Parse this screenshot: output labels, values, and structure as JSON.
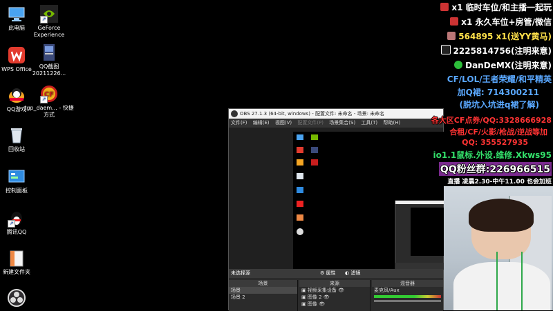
{
  "desktop": {
    "icons": [
      {
        "label": "此电脑",
        "icon": "computer-icon"
      },
      {
        "label": "GeForce Experience",
        "icon": "geforce-icon"
      },
      {
        "label": "WPS Office",
        "icon": "wps-icon"
      },
      {
        "label": "QQ截图 20211226...",
        "icon": "image-file-icon"
      },
      {
        "label": "QQ游戏",
        "icon": "qq-game-icon"
      },
      {
        "label": "tgp_daem... - 快捷方式",
        "icon": "cf-icon"
      },
      {
        "label": "回收站",
        "icon": "recycle-bin-icon"
      },
      {
        "label": "控制面板",
        "icon": "control-panel-icon"
      },
      {
        "label": "腾讯QQ",
        "icon": "qq-icon"
      },
      {
        "label": "新建文件夹",
        "icon": "folder-icon"
      },
      {
        "label": "",
        "icon": "obs-icon"
      }
    ]
  },
  "obs": {
    "title": "OBS 27.1.3 (64-bit, windows) - 配置文件: 未命名 - 场景: 未命名",
    "menu": [
      "文件(F)",
      "编辑(E)",
      "视图(V)",
      "配置文件(P)",
      "场景集合(S)",
      "工具(T)",
      "帮助(H)"
    ],
    "source_bar": {
      "label": "未选择源",
      "properties": "属性",
      "filters": "滤镜"
    },
    "docks": {
      "scenes": {
        "title": "场景",
        "items": [
          "场景",
          "场景 2"
        ]
      },
      "sources": {
        "title": "来源",
        "items": [
          "视频采集设备",
          "图像 2",
          "图像"
        ]
      },
      "mixer": {
        "title": "混音器",
        "track": "麦克风/Aux"
      }
    }
  },
  "overlay": {
    "lines": [
      {
        "text": "x1 临时车位/和主播一起玩",
        "color": "#ffffff",
        "icon": "car-icon"
      },
      {
        "text": "x1 永久车位+房管/微信",
        "color": "#ffffff",
        "icon": "car-icon"
      },
      {
        "text": "564895 x1(送YY黄马)",
        "color": "#ffe14a",
        "icon": "owl-icon"
      },
      {
        "text": "2225814756(注明来意)",
        "color": "#ffffff",
        "icon": "qq-penguin-icon"
      },
      {
        "text": "DanDeMX(注明来意)",
        "color": "#ffffff",
        "icon": "wechat-icon"
      },
      {
        "text": "CF/LOL/王者荣耀/和平精英",
        "color": "#5aa8ff",
        "icon": ""
      },
      {
        "text": "加Q裙: 714300211",
        "color": "#5aa8ff",
        "icon": ""
      },
      {
        "text": "(脱坑入坑进q裙了解)",
        "color": "#5aa8ff",
        "icon": ""
      },
      {
        "text": "各大区CF点券/QQ:3328666928",
        "color": "#ff3333",
        "icon": ""
      },
      {
        "text": "合租/CF/火影/枪战/逆战等加",
        "color": "#ff3333",
        "icon": ""
      },
      {
        "text": "QQ: 355527935",
        "color": "#ff3333",
        "icon": ""
      },
      {
        "text": "io1.1鼠标.外设.维修.Xkws95",
        "color": "#33e06a",
        "icon": ""
      },
      {
        "text": "QQ粉丝群:226966515",
        "color": "#ffffff",
        "icon": ""
      },
      {
        "text": "直播 凌晨2.30-中午11.00 也会加班",
        "color": "#ffffff",
        "icon": ""
      }
    ]
  }
}
